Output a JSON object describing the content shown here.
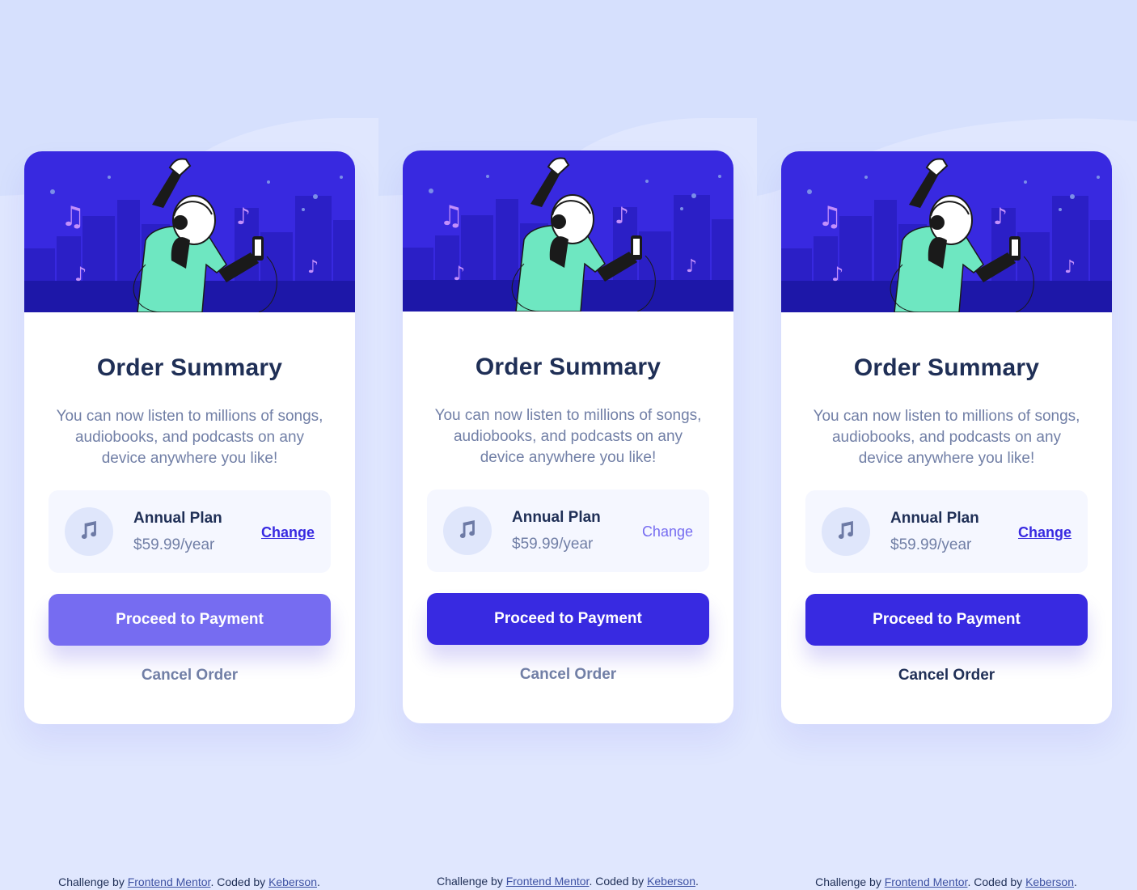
{
  "cards": [
    {
      "title": "Order Summary",
      "description": "You can now listen to millions of songs, audiobooks, and podcasts on any device anywhere you like!",
      "plan_name": "Annual Plan",
      "plan_price": "$59.99/year",
      "change_label": "Change",
      "pay_label": "Proceed to Payment",
      "cancel_label": "Cancel Order"
    },
    {
      "title": "Order Summary",
      "description": "You can now listen to millions of songs, audiobooks, and podcasts on any device anywhere you like!",
      "plan_name": "Annual Plan",
      "plan_price": "$59.99/year",
      "change_label": "Change",
      "pay_label": "Proceed to Payment",
      "cancel_label": "Cancel Order"
    },
    {
      "title": "Order Summary",
      "description": "You can now listen to millions of songs, audiobooks, and podcasts on any device anywhere you like!",
      "plan_name": "Annual Plan",
      "plan_price": "$59.99/year",
      "change_label": "Change",
      "pay_label": "Proceed to Payment",
      "cancel_label": "Cancel Order"
    }
  ],
  "footer": {
    "challenge_text": "Challenge by ",
    "frontend_mentor_link": "Frontend Mentor",
    "coded_text": ". Coded by ",
    "author_link": "Keberson",
    "end_text": "."
  },
  "colors": {
    "background": "#e0e7fe",
    "primary_button": "#382ae1",
    "primary_button_hover": "#766cf1",
    "title": "#1f2f56",
    "body_text": "#717fa6",
    "plan_bg": "#f5f7ff",
    "hero_bg": "#3829e0"
  },
  "icons": {
    "plan_icon": "music-note-icon",
    "hero": "hero-illustration-dancing-person"
  }
}
